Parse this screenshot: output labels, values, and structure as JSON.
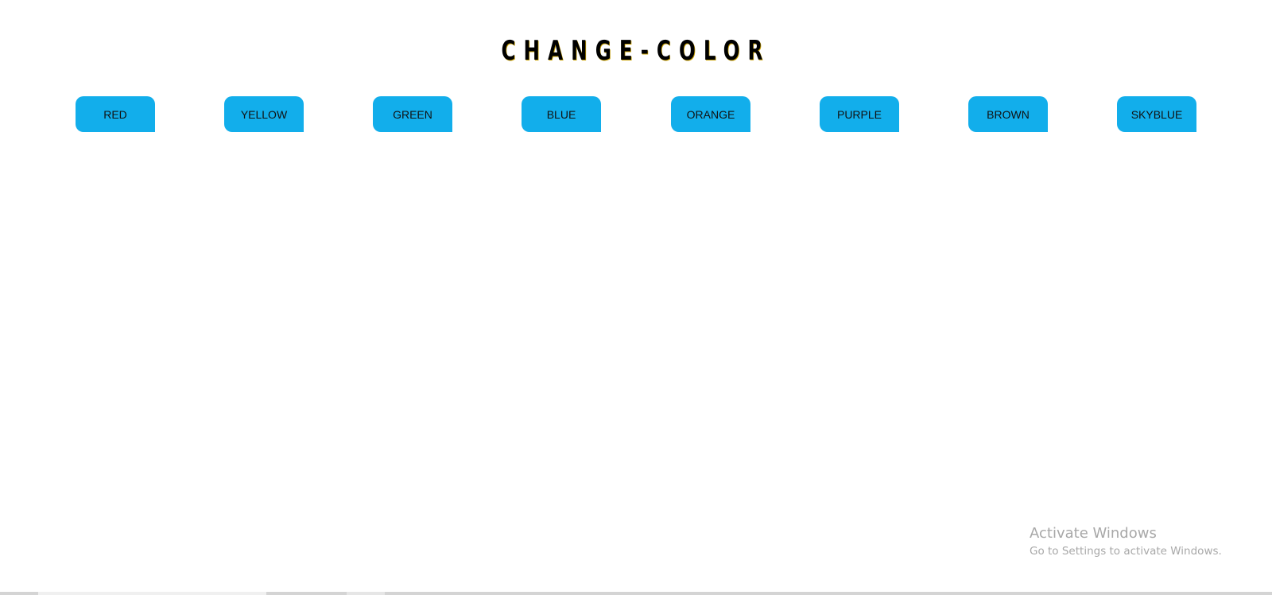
{
  "page": {
    "title": "CHANGE-COLOR"
  },
  "buttons": [
    {
      "label": "RED"
    },
    {
      "label": "YELLOW"
    },
    {
      "label": "GREEN"
    },
    {
      "label": "BLUE"
    },
    {
      "label": "ORANGE"
    },
    {
      "label": "PURPLE"
    },
    {
      "label": "BROWN"
    },
    {
      "label": "SKYBLUE"
    }
  ],
  "watermark": {
    "title": "Activate Windows",
    "subtitle": "Go to Settings to activate Windows."
  },
  "colors": {
    "button_bg": "#12aeeb",
    "page_bg": "#ffffff",
    "title_color": "#000000"
  }
}
